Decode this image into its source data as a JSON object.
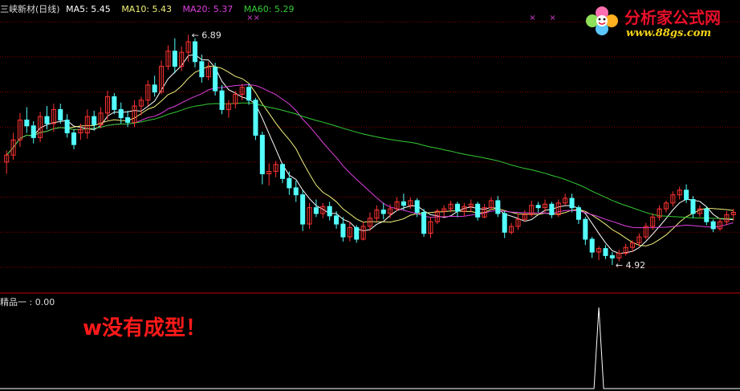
{
  "header": {
    "stock_name": "三峡新材(日线)",
    "ma5_label": "MA5: 5.45",
    "ma10_label": "MA10: 5.43",
    "ma20_label": "MA20: 5.37",
    "ma60_label": "MA60: 5.29"
  },
  "indicator": {
    "label": "精品一 : 0.00",
    "annotation": "w没有成型！"
  },
  "logo": {
    "title": "分析家公式网",
    "url": "www.88gs.com"
  },
  "colors": {
    "up": "#ff3333",
    "down": "#54ffff",
    "ma5": "#ffffff",
    "ma10": "#f2f27a",
    "ma20": "#e040e0",
    "ma60": "#33cc33",
    "grid": "#8b0000"
  },
  "chart_data": [
    {
      "type": "candlestick",
      "title": "三峡新材(日线)",
      "ylim": [
        4.7,
        7.05
      ],
      "grid_levels": [
        4.9,
        5.2,
        5.5,
        5.8,
        6.1,
        6.4,
        6.7,
        7.0
      ],
      "annotations": [
        {
          "text": "6.89",
          "at_index": 27,
          "value": 6.89
        },
        {
          "text": "4.92",
          "at_index": 90,
          "value": 4.92
        }
      ],
      "marker_indices": [
        36,
        37,
        78,
        81
      ],
      "ohlc": [
        [
          5.8,
          5.9,
          5.7,
          5.86
        ],
        [
          5.86,
          6.05,
          5.82,
          5.99
        ],
        [
          5.99,
          6.22,
          5.93,
          6.16
        ],
        [
          6.16,
          6.27,
          6.05,
          6.11
        ],
        [
          6.11,
          6.15,
          5.96,
          6.01
        ],
        [
          6.01,
          6.23,
          5.97,
          6.19
        ],
        [
          6.19,
          6.28,
          6.08,
          6.13
        ],
        [
          6.13,
          6.3,
          6.06,
          6.25
        ],
        [
          6.25,
          6.3,
          6.13,
          6.16
        ],
        [
          6.16,
          6.21,
          6.01,
          6.05
        ],
        [
          6.05,
          6.08,
          5.91,
          5.95
        ],
        [
          6.05,
          6.13,
          5.99,
          6.08
        ],
        [
          6.05,
          6.25,
          6.0,
          6.19
        ],
        [
          6.19,
          6.24,
          6.07,
          6.12
        ],
        [
          6.12,
          6.27,
          6.09,
          6.22
        ],
        [
          6.22,
          6.41,
          6.16,
          6.36
        ],
        [
          6.36,
          6.39,
          6.21,
          6.25
        ],
        [
          6.25,
          6.31,
          6.13,
          6.18
        ],
        [
          6.18,
          6.24,
          6.1,
          6.14
        ],
        [
          6.14,
          6.33,
          6.1,
          6.28
        ],
        [
          6.28,
          6.36,
          6.2,
          6.33
        ],
        [
          6.33,
          6.5,
          6.28,
          6.46
        ],
        [
          6.46,
          6.54,
          6.36,
          6.4
        ],
        [
          6.4,
          6.67,
          6.38,
          6.62
        ],
        [
          6.62,
          6.8,
          6.59,
          6.75
        ],
        [
          6.75,
          6.86,
          6.56,
          6.62
        ],
        [
          6.62,
          6.79,
          6.58,
          6.74
        ],
        [
          6.74,
          6.89,
          6.66,
          6.83
        ],
        [
          6.83,
          6.86,
          6.61,
          6.66
        ],
        [
          6.66,
          6.72,
          6.48,
          6.53
        ],
        [
          6.53,
          6.66,
          6.5,
          6.61
        ],
        [
          6.61,
          6.65,
          6.37,
          6.41
        ],
        [
          6.41,
          6.46,
          6.21,
          6.25
        ],
        [
          6.25,
          6.33,
          6.18,
          6.3
        ],
        [
          6.3,
          6.41,
          6.26,
          6.38
        ],
        [
          6.38,
          6.47,
          6.33,
          6.44
        ],
        [
          6.44,
          6.47,
          6.29,
          6.33
        ],
        [
          6.33,
          6.35,
          5.99,
          6.03
        ],
        [
          6.03,
          6.06,
          5.61,
          5.7
        ],
        [
          5.7,
          5.79,
          5.6,
          5.72
        ],
        [
          5.72,
          5.81,
          5.67,
          5.78
        ],
        [
          5.78,
          5.79,
          5.62,
          5.66
        ],
        [
          5.66,
          5.72,
          5.52,
          5.58
        ],
        [
          5.58,
          5.64,
          5.46,
          5.52
        ],
        [
          5.52,
          5.56,
          5.21,
          5.27
        ],
        [
          5.27,
          5.45,
          5.23,
          5.41
        ],
        [
          5.41,
          5.48,
          5.33,
          5.36
        ],
        [
          5.36,
          5.45,
          5.32,
          5.42
        ],
        [
          5.42,
          5.46,
          5.3,
          5.34
        ],
        [
          5.34,
          5.38,
          5.23,
          5.27
        ],
        [
          5.27,
          5.33,
          5.12,
          5.16
        ],
        [
          5.16,
          5.29,
          5.12,
          5.24
        ],
        [
          5.24,
          5.26,
          5.11,
          5.14
        ],
        [
          5.14,
          5.29,
          5.13,
          5.25
        ],
        [
          5.25,
          5.37,
          5.21,
          5.32
        ],
        [
          5.32,
          5.43,
          5.29,
          5.39
        ],
        [
          5.39,
          5.45,
          5.31,
          5.36
        ],
        [
          5.36,
          5.44,
          5.32,
          5.4
        ],
        [
          5.4,
          5.5,
          5.38,
          5.46
        ],
        [
          5.46,
          5.53,
          5.39,
          5.43
        ],
        [
          5.43,
          5.5,
          5.4,
          5.47
        ],
        [
          5.47,
          5.49,
          5.33,
          5.37
        ],
        [
          5.37,
          5.4,
          5.16,
          5.19
        ],
        [
          5.19,
          5.33,
          5.15,
          5.29
        ],
        [
          5.29,
          5.4,
          5.27,
          5.38
        ],
        [
          5.38,
          5.43,
          5.33,
          5.4
        ],
        [
          5.4,
          5.47,
          5.37,
          5.44
        ],
        [
          5.44,
          5.46,
          5.33,
          5.38
        ],
        [
          5.38,
          5.45,
          5.34,
          5.42
        ],
        [
          5.42,
          5.48,
          5.37,
          5.44
        ],
        [
          5.44,
          5.46,
          5.3,
          5.33
        ],
        [
          5.33,
          5.44,
          5.32,
          5.41
        ],
        [
          5.41,
          5.5,
          5.39,
          5.47
        ],
        [
          5.47,
          5.51,
          5.33,
          5.36
        ],
        [
          5.36,
          5.38,
          5.15,
          5.2
        ],
        [
          5.2,
          5.28,
          5.18,
          5.25
        ],
        [
          5.25,
          5.36,
          5.22,
          5.31
        ],
        [
          5.31,
          5.39,
          5.29,
          5.35
        ],
        [
          5.35,
          5.47,
          5.33,
          5.43
        ],
        [
          5.43,
          5.46,
          5.37,
          5.41
        ],
        [
          5.41,
          5.48,
          5.37,
          5.44
        ],
        [
          5.44,
          5.46,
          5.32,
          5.35
        ],
        [
          5.35,
          5.48,
          5.33,
          5.45
        ],
        [
          5.45,
          5.53,
          5.43,
          5.49
        ],
        [
          5.49,
          5.53,
          5.37,
          5.41
        ],
        [
          5.41,
          5.43,
          5.27,
          5.31
        ],
        [
          5.31,
          5.33,
          5.09,
          5.14
        ],
        [
          5.14,
          5.16,
          4.98,
          5.03
        ],
        [
          5.03,
          5.08,
          4.96,
          5.06
        ],
        [
          5.06,
          5.09,
          4.97,
          5.0
        ],
        [
          5.0,
          5.03,
          4.92,
          4.98
        ],
        [
          4.98,
          5.05,
          4.95,
          5.02
        ],
        [
          5.02,
          5.1,
          5.0,
          5.07
        ],
        [
          5.07,
          5.13,
          5.03,
          5.11
        ],
        [
          5.11,
          5.19,
          5.08,
          5.16
        ],
        [
          5.16,
          5.28,
          5.14,
          5.25
        ],
        [
          5.25,
          5.36,
          5.22,
          5.33
        ],
        [
          5.33,
          5.43,
          5.3,
          5.4
        ],
        [
          5.4,
          5.47,
          5.37,
          5.45
        ],
        [
          5.45,
          5.55,
          5.42,
          5.52
        ],
        [
          5.52,
          5.59,
          5.48,
          5.56
        ],
        [
          5.56,
          5.61,
          5.45,
          5.48
        ],
        [
          5.48,
          5.51,
          5.32,
          5.36
        ],
        [
          5.36,
          5.43,
          5.33,
          5.4
        ],
        [
          5.4,
          5.42,
          5.26,
          5.29
        ],
        [
          5.29,
          5.31,
          5.2,
          5.23
        ],
        [
          5.23,
          5.32,
          5.21,
          5.29
        ],
        [
          5.29,
          5.38,
          5.26,
          5.35
        ],
        [
          5.35,
          5.4,
          5.3,
          5.37
        ]
      ],
      "ma_series": [
        {
          "name": "MA5",
          "period": 5,
          "color": "#ffffff"
        },
        {
          "name": "MA10",
          "period": 10,
          "color": "#f2f27a"
        },
        {
          "name": "MA20",
          "period": 20,
          "color": "#e040e0"
        },
        {
          "name": "MA60",
          "period": 60,
          "color": "#33cc33"
        }
      ]
    },
    {
      "type": "line",
      "title": "精品一",
      "ylim": [
        0,
        1
      ],
      "series": [
        {
          "name": "精品一",
          "spike_index": 88,
          "spike_value": 1,
          "baseline": 0
        }
      ]
    }
  ]
}
